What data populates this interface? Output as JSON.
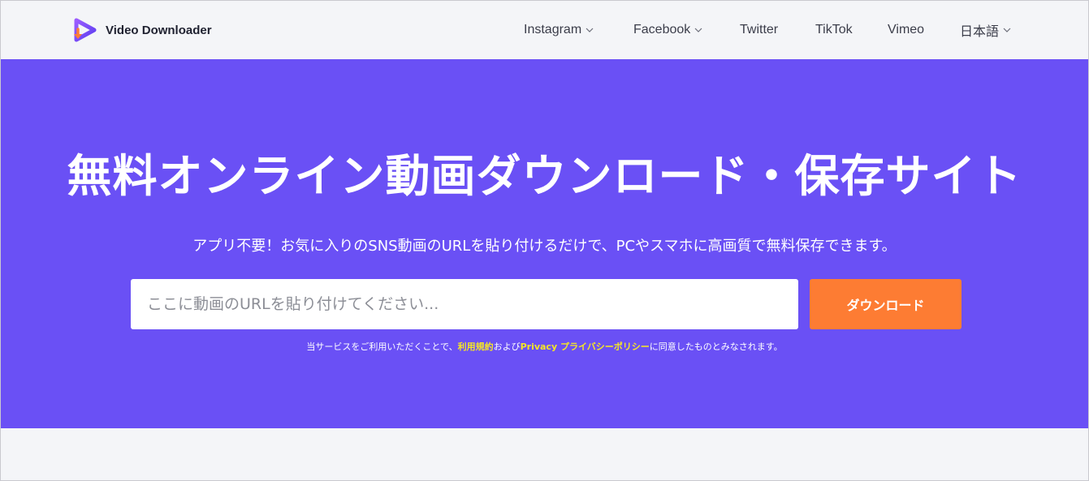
{
  "colors": {
    "hero_background": "#6a50f5",
    "download_button": "#fd7c33",
    "terms_link": "#f5e626",
    "header_background": "#f4f5f8"
  },
  "header": {
    "logo_text": "Video Downloader",
    "logo_icon": "play-download-icon",
    "nav": [
      {
        "label": "Instagram",
        "has_dropdown": true
      },
      {
        "label": "Facebook",
        "has_dropdown": true
      },
      {
        "label": "Twitter",
        "has_dropdown": false
      },
      {
        "label": "TikTok",
        "has_dropdown": false
      },
      {
        "label": "Vimeo",
        "has_dropdown": false
      },
      {
        "label": "日本語",
        "has_dropdown": true
      }
    ]
  },
  "hero": {
    "title": "無料オンライン動画ダウンロード・保存サイト",
    "subtitle": "アプリ不要！お気に入りのSNS動画のURLを貼り付けるだけで、PCやスマホに高画質で無料保存できます。",
    "input_placeholder": "ここに動画のURLを貼り付けてください...",
    "button_label": "ダウンロード",
    "terms": {
      "prefix": "当サービスをご利用いただくことで、",
      "terms_link": "利用規約",
      "middle": "および",
      "privacy_link": "Privacy プライバシーポリシー",
      "suffix": "に同意したものとみなされます。"
    }
  }
}
